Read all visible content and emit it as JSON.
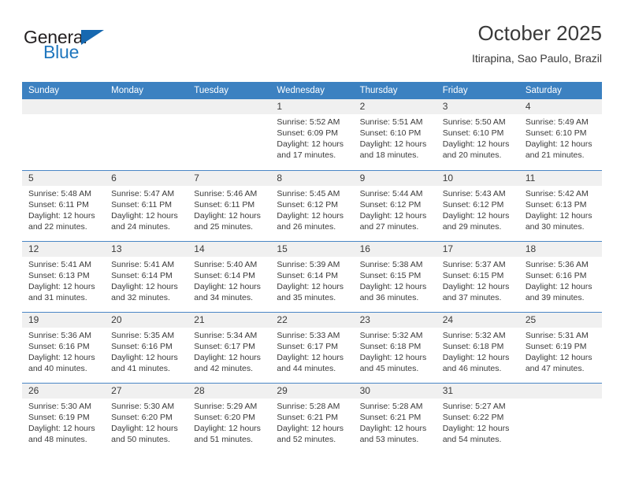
{
  "brand": {
    "name_top": "General",
    "name_bottom": "Blue",
    "triangle_icon": "blue-triangle-logo-mark",
    "color_dark": "#231f20",
    "color_blue": "#2077be"
  },
  "header": {
    "title": "October 2025",
    "subtitle": "Itirapina, Sao Paulo, Brazil"
  },
  "theme": {
    "header_bg": "#3c81c1",
    "header_text": "#ffffff",
    "daynum_bg": "#f0f0f0",
    "row_border": "#4a86c5",
    "body_text": "#3a3a3a"
  },
  "weekdays": [
    "Sunday",
    "Monday",
    "Tuesday",
    "Wednesday",
    "Thursday",
    "Friday",
    "Saturday"
  ],
  "weeks": [
    {
      "days": [
        {
          "day": "",
          "lines": []
        },
        {
          "day": "",
          "lines": []
        },
        {
          "day": "",
          "lines": []
        },
        {
          "day": "1",
          "lines": [
            "Sunrise: 5:52 AM",
            "Sunset: 6:09 PM",
            "Daylight: 12 hours",
            "and 17 minutes."
          ]
        },
        {
          "day": "2",
          "lines": [
            "Sunrise: 5:51 AM",
            "Sunset: 6:10 PM",
            "Daylight: 12 hours",
            "and 18 minutes."
          ]
        },
        {
          "day": "3",
          "lines": [
            "Sunrise: 5:50 AM",
            "Sunset: 6:10 PM",
            "Daylight: 12 hours",
            "and 20 minutes."
          ]
        },
        {
          "day": "4",
          "lines": [
            "Sunrise: 5:49 AM",
            "Sunset: 6:10 PM",
            "Daylight: 12 hours",
            "and 21 minutes."
          ]
        }
      ]
    },
    {
      "days": [
        {
          "day": "5",
          "lines": [
            "Sunrise: 5:48 AM",
            "Sunset: 6:11 PM",
            "Daylight: 12 hours",
            "and 22 minutes."
          ]
        },
        {
          "day": "6",
          "lines": [
            "Sunrise: 5:47 AM",
            "Sunset: 6:11 PM",
            "Daylight: 12 hours",
            "and 24 minutes."
          ]
        },
        {
          "day": "7",
          "lines": [
            "Sunrise: 5:46 AM",
            "Sunset: 6:11 PM",
            "Daylight: 12 hours",
            "and 25 minutes."
          ]
        },
        {
          "day": "8",
          "lines": [
            "Sunrise: 5:45 AM",
            "Sunset: 6:12 PM",
            "Daylight: 12 hours",
            "and 26 minutes."
          ]
        },
        {
          "day": "9",
          "lines": [
            "Sunrise: 5:44 AM",
            "Sunset: 6:12 PM",
            "Daylight: 12 hours",
            "and 27 minutes."
          ]
        },
        {
          "day": "10",
          "lines": [
            "Sunrise: 5:43 AM",
            "Sunset: 6:12 PM",
            "Daylight: 12 hours",
            "and 29 minutes."
          ]
        },
        {
          "day": "11",
          "lines": [
            "Sunrise: 5:42 AM",
            "Sunset: 6:13 PM",
            "Daylight: 12 hours",
            "and 30 minutes."
          ]
        }
      ]
    },
    {
      "days": [
        {
          "day": "12",
          "lines": [
            "Sunrise: 5:41 AM",
            "Sunset: 6:13 PM",
            "Daylight: 12 hours",
            "and 31 minutes."
          ]
        },
        {
          "day": "13",
          "lines": [
            "Sunrise: 5:41 AM",
            "Sunset: 6:14 PM",
            "Daylight: 12 hours",
            "and 32 minutes."
          ]
        },
        {
          "day": "14",
          "lines": [
            "Sunrise: 5:40 AM",
            "Sunset: 6:14 PM",
            "Daylight: 12 hours",
            "and 34 minutes."
          ]
        },
        {
          "day": "15",
          "lines": [
            "Sunrise: 5:39 AM",
            "Sunset: 6:14 PM",
            "Daylight: 12 hours",
            "and 35 minutes."
          ]
        },
        {
          "day": "16",
          "lines": [
            "Sunrise: 5:38 AM",
            "Sunset: 6:15 PM",
            "Daylight: 12 hours",
            "and 36 minutes."
          ]
        },
        {
          "day": "17",
          "lines": [
            "Sunrise: 5:37 AM",
            "Sunset: 6:15 PM",
            "Daylight: 12 hours",
            "and 37 minutes."
          ]
        },
        {
          "day": "18",
          "lines": [
            "Sunrise: 5:36 AM",
            "Sunset: 6:16 PM",
            "Daylight: 12 hours",
            "and 39 minutes."
          ]
        }
      ]
    },
    {
      "days": [
        {
          "day": "19",
          "lines": [
            "Sunrise: 5:36 AM",
            "Sunset: 6:16 PM",
            "Daylight: 12 hours",
            "and 40 minutes."
          ]
        },
        {
          "day": "20",
          "lines": [
            "Sunrise: 5:35 AM",
            "Sunset: 6:16 PM",
            "Daylight: 12 hours",
            "and 41 minutes."
          ]
        },
        {
          "day": "21",
          "lines": [
            "Sunrise: 5:34 AM",
            "Sunset: 6:17 PM",
            "Daylight: 12 hours",
            "and 42 minutes."
          ]
        },
        {
          "day": "22",
          "lines": [
            "Sunrise: 5:33 AM",
            "Sunset: 6:17 PM",
            "Daylight: 12 hours",
            "and 44 minutes."
          ]
        },
        {
          "day": "23",
          "lines": [
            "Sunrise: 5:32 AM",
            "Sunset: 6:18 PM",
            "Daylight: 12 hours",
            "and 45 minutes."
          ]
        },
        {
          "day": "24",
          "lines": [
            "Sunrise: 5:32 AM",
            "Sunset: 6:18 PM",
            "Daylight: 12 hours",
            "and 46 minutes."
          ]
        },
        {
          "day": "25",
          "lines": [
            "Sunrise: 5:31 AM",
            "Sunset: 6:19 PM",
            "Daylight: 12 hours",
            "and 47 minutes."
          ]
        }
      ]
    },
    {
      "days": [
        {
          "day": "26",
          "lines": [
            "Sunrise: 5:30 AM",
            "Sunset: 6:19 PM",
            "Daylight: 12 hours",
            "and 48 minutes."
          ]
        },
        {
          "day": "27",
          "lines": [
            "Sunrise: 5:30 AM",
            "Sunset: 6:20 PM",
            "Daylight: 12 hours",
            "and 50 minutes."
          ]
        },
        {
          "day": "28",
          "lines": [
            "Sunrise: 5:29 AM",
            "Sunset: 6:20 PM",
            "Daylight: 12 hours",
            "and 51 minutes."
          ]
        },
        {
          "day": "29",
          "lines": [
            "Sunrise: 5:28 AM",
            "Sunset: 6:21 PM",
            "Daylight: 12 hours",
            "and 52 minutes."
          ]
        },
        {
          "day": "30",
          "lines": [
            "Sunrise: 5:28 AM",
            "Sunset: 6:21 PM",
            "Daylight: 12 hours",
            "and 53 minutes."
          ]
        },
        {
          "day": "31",
          "lines": [
            "Sunrise: 5:27 AM",
            "Sunset: 6:22 PM",
            "Daylight: 12 hours",
            "and 54 minutes."
          ]
        },
        {
          "day": "",
          "lines": []
        }
      ]
    }
  ]
}
